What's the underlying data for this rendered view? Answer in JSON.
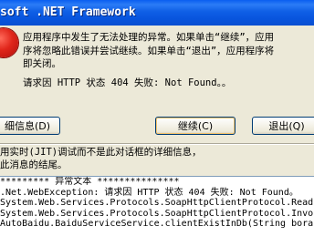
{
  "window": {
    "title": "soft .NET Framework"
  },
  "message": {
    "lines": [
      "应用程序中发生了无法处理的异常。如果单击“继续”，应用",
      "序将忽略此错误并尝试继续。如果单击“退出”，应用程序将",
      "即关闭。"
    ],
    "detail": "请求因 HTTP 状态 404 失败: Not Found。。"
  },
  "buttons": {
    "details": "细信息(D)",
    "continue": "继续(C)",
    "exit": "退出(Q)"
  },
  "info": {
    "lines": [
      "用实时(JIT)调试而不是此对话框的详细信息，",
      "此消息的结尾。"
    ]
  },
  "stack": {
    "lines": [
      "********* 异常文本 ***************",
      ".Net.WebException: 请求因 HTTP 状态 404 失败: Not Found。",
      "System.Web.Services.Protocols.SoapHttpClientProtocol.Read",
      "System.Web.Services.Protocols.SoapHttpClientProtocol.Invo",
      "AutoBaidu.BaiduServiceService.clientExistInDb(String bora"
    ]
  },
  "colors": {
    "titlebar": "#0a5ef0",
    "error_icon": "#e0261b",
    "dialog_bg": "#ece9d8"
  },
  "icons": {
    "error": "error-icon"
  }
}
